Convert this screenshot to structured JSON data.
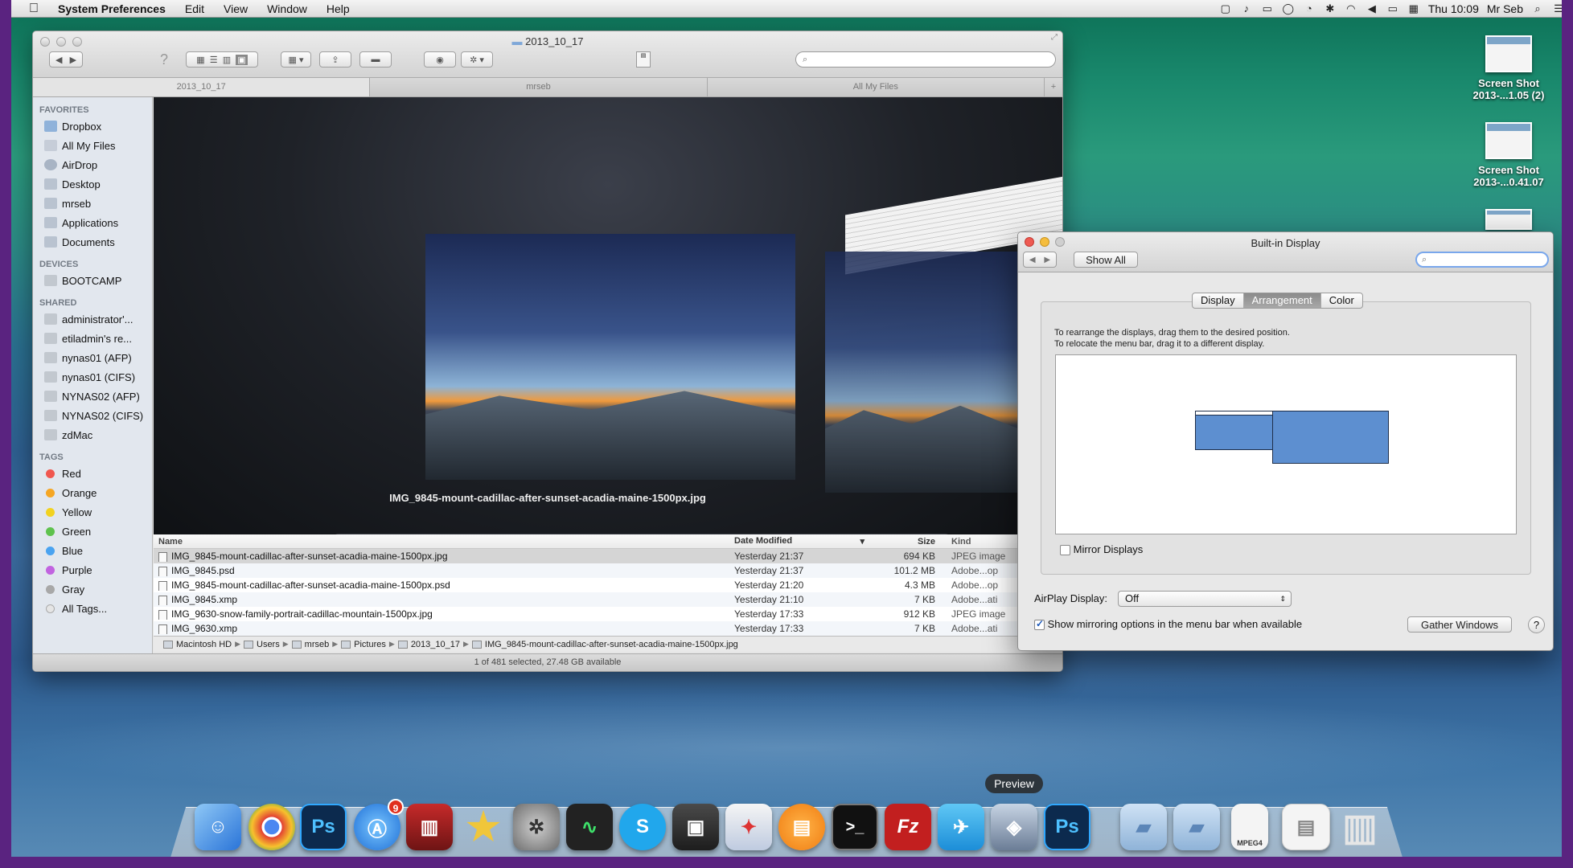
{
  "menubar": {
    "app": "System Preferences",
    "items": [
      "Edit",
      "View",
      "Window",
      "Help"
    ],
    "clock": "Thu 10:09",
    "user": "Mr Seb"
  },
  "finder": {
    "title": "2013_10_17",
    "tabs": [
      "2013_10_17",
      "mrseb",
      "All My Files"
    ],
    "sidebar": {
      "favorites_header": "FAVORITES",
      "favorites": [
        "Dropbox",
        "All My Files",
        "AirDrop",
        "Desktop",
        "mrseb",
        "Applications",
        "Documents"
      ],
      "devices_header": "DEVICES",
      "devices": [
        "BOOTCAMP"
      ],
      "shared_header": "SHARED",
      "shared": [
        "administrator'...",
        "etiladmin's re...",
        "nynas01 (AFP)",
        "nynas01 (CIFS)",
        "NYNAS02 (AFP)",
        "NYNAS02 (CIFS)",
        "zdMac"
      ],
      "tags_header": "TAGS",
      "tags": [
        {
          "name": "Red",
          "color": "#f0574f"
        },
        {
          "name": "Orange",
          "color": "#f5a623"
        },
        {
          "name": "Yellow",
          "color": "#f2d21f"
        },
        {
          "name": "Green",
          "color": "#5ec24d"
        },
        {
          "name": "Blue",
          "color": "#4aa3f0"
        },
        {
          "name": "Purple",
          "color": "#c163e0"
        },
        {
          "name": "Gray",
          "color": "#a8a8a8"
        },
        {
          "name": "All Tags...",
          "color": "#e5e5e5"
        }
      ]
    },
    "coverflow_caption": "IMG_9845-mount-cadillac-after-sunset-acadia-maine-1500px.jpg",
    "columns": {
      "name": "Name",
      "date": "Date Modified",
      "size": "Size",
      "kind": "Kind"
    },
    "files": [
      {
        "name": "IMG_9845-mount-cadillac-after-sunset-acadia-maine-1500px.jpg",
        "date": "Yesterday 21:37",
        "size": "694 KB",
        "kind": "JPEG image"
      },
      {
        "name": "IMG_9845.psd",
        "date": "Yesterday 21:37",
        "size": "101.2 MB",
        "kind": "Adobe...op"
      },
      {
        "name": "IMG_9845-mount-cadillac-after-sunset-acadia-maine-1500px.psd",
        "date": "Yesterday 21:20",
        "size": "4.3 MB",
        "kind": "Adobe...op"
      },
      {
        "name": "IMG_9845.xmp",
        "date": "Yesterday 21:10",
        "size": "7 KB",
        "kind": "Adobe...ati"
      },
      {
        "name": "IMG_9630-snow-family-portrait-cadillac-mountain-1500px.jpg",
        "date": "Yesterday 17:33",
        "size": "912 KB",
        "kind": "JPEG image"
      },
      {
        "name": "IMG_9630.xmp",
        "date": "Yesterday 17:33",
        "size": "7 KB",
        "kind": "Adobe...ati"
      }
    ],
    "path": [
      "Macintosh HD",
      "Users",
      "mrseb",
      "Pictures",
      "2013_10_17",
      "IMG_9845-mount-cadillac-after-sunset-acadia-maine-1500px.jpg"
    ],
    "status": "1 of 481 selected, 27.48 GB available"
  },
  "prefs": {
    "title": "Built-in Display",
    "show_all": "Show All",
    "tabs": [
      "Display",
      "Arrangement",
      "Color"
    ],
    "instructions_1": "To rearrange the displays, drag them to the desired position.",
    "instructions_2": "To relocate the menu bar, drag it to a different display.",
    "mirror_label": "Mirror Displays",
    "airplay_label": "AirPlay Display:",
    "airplay_value": "Off",
    "mirroring_option": "Show mirroring options in the menu bar when available",
    "gather_button": "Gather Windows",
    "help": "?"
  },
  "desktop": {
    "icons": [
      {
        "line1": "Screen Shot",
        "line2": "2013-...1.05 (2)"
      },
      {
        "line1": "Screen Shot",
        "line2": "2013-...0.41.07"
      }
    ]
  },
  "dock": {
    "tooltip": "Preview",
    "appstore_badge": "9",
    "ps_label": "Ps",
    "fz_label": "Fz",
    "mpeg_label": "MPEG4"
  }
}
